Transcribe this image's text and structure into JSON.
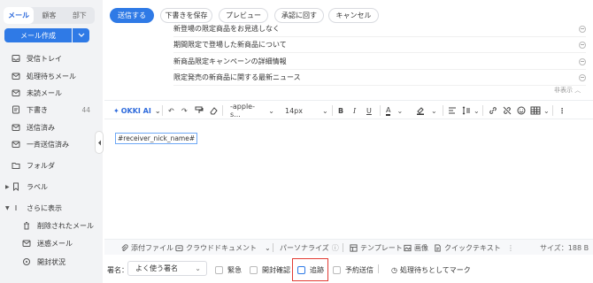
{
  "sidebar": {
    "tabs": [
      "メール",
      "顧客",
      "部下"
    ],
    "active_tab": "メール",
    "compose_label": "メール作成",
    "items": [
      {
        "label": "受信トレイ",
        "icon": "inbox-icon"
      },
      {
        "label": "処理待ちメール",
        "icon": "pending-mail-icon"
      },
      {
        "label": "未読メール",
        "icon": "unread-mail-icon"
      },
      {
        "label": "下書き",
        "icon": "draft-icon",
        "count": "44"
      },
      {
        "label": "送信済み",
        "icon": "sent-icon"
      },
      {
        "label": "一斉送信済み",
        "icon": "bulk-sent-icon"
      },
      {
        "label": "フォルダ",
        "icon": "folder-icon"
      },
      {
        "label": "ラベル",
        "icon": "label-icon"
      },
      {
        "label": "さらに表示",
        "icon": "more-icon"
      },
      {
        "label": "削除されたメール",
        "icon": "trash-icon"
      },
      {
        "label": "迷惑メール",
        "icon": "spam-icon"
      },
      {
        "label": "開封状況",
        "icon": "open-status-icon"
      }
    ]
  },
  "top_buttons": {
    "send": "送信する",
    "save_draft": "下書きを保存",
    "preview": "プレビュー",
    "approval": "承認に回す",
    "cancel": "キャンセル"
  },
  "suggestions": [
    "新登場の限定商品をお見逃しなく",
    "期間限定で登場した新商品について",
    "新商品限定キャンペーンの詳細情報",
    "限定発売の新商品に関する最新ニュース"
  ],
  "hide_label": "非表示",
  "editor_toolbar": {
    "ai_label": "OKKI AI",
    "font_family": "-apple-s...",
    "font_size": "14px"
  },
  "editor": {
    "placeholder_tag": "#receiver_nick_name#"
  },
  "attach_bar": {
    "attach_file": "添付ファイル",
    "cloud_doc": "クラウドドキュメント",
    "personalize": "パーソナライズ",
    "template": "テンプレート",
    "image": "画像",
    "quick_text": "クイックテキスト",
    "size_label": "サイズ：188 B"
  },
  "bottom_bar": {
    "signature_label": "署名：",
    "signature_value": "よく使う署名",
    "urgent": "緊急",
    "read_receipt": "開封確認",
    "track": "追跡",
    "scheduled": "予約送信",
    "mark_pending": "処理待ちとしてマーク"
  },
  "colors": {
    "accent": "#2f7ae6",
    "highlight": "#e23b33"
  }
}
